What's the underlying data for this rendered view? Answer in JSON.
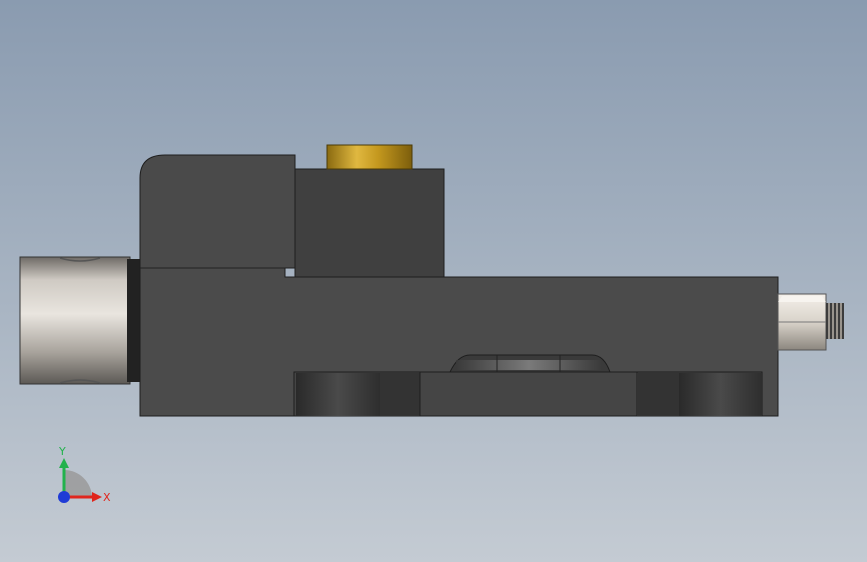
{
  "triad": {
    "x_label": "X",
    "y_label": "Y",
    "x_color": "#e0261d",
    "y_color": "#22b24c",
    "z_color": "#1f3bd6"
  },
  "model": {
    "body_color": "#4a4a4a",
    "body_dark_color": "#3c3c3c",
    "brass_color": "#c49a1e",
    "cylinder_color": "#bdb8b0",
    "nut_color": "#d8d3cb"
  }
}
